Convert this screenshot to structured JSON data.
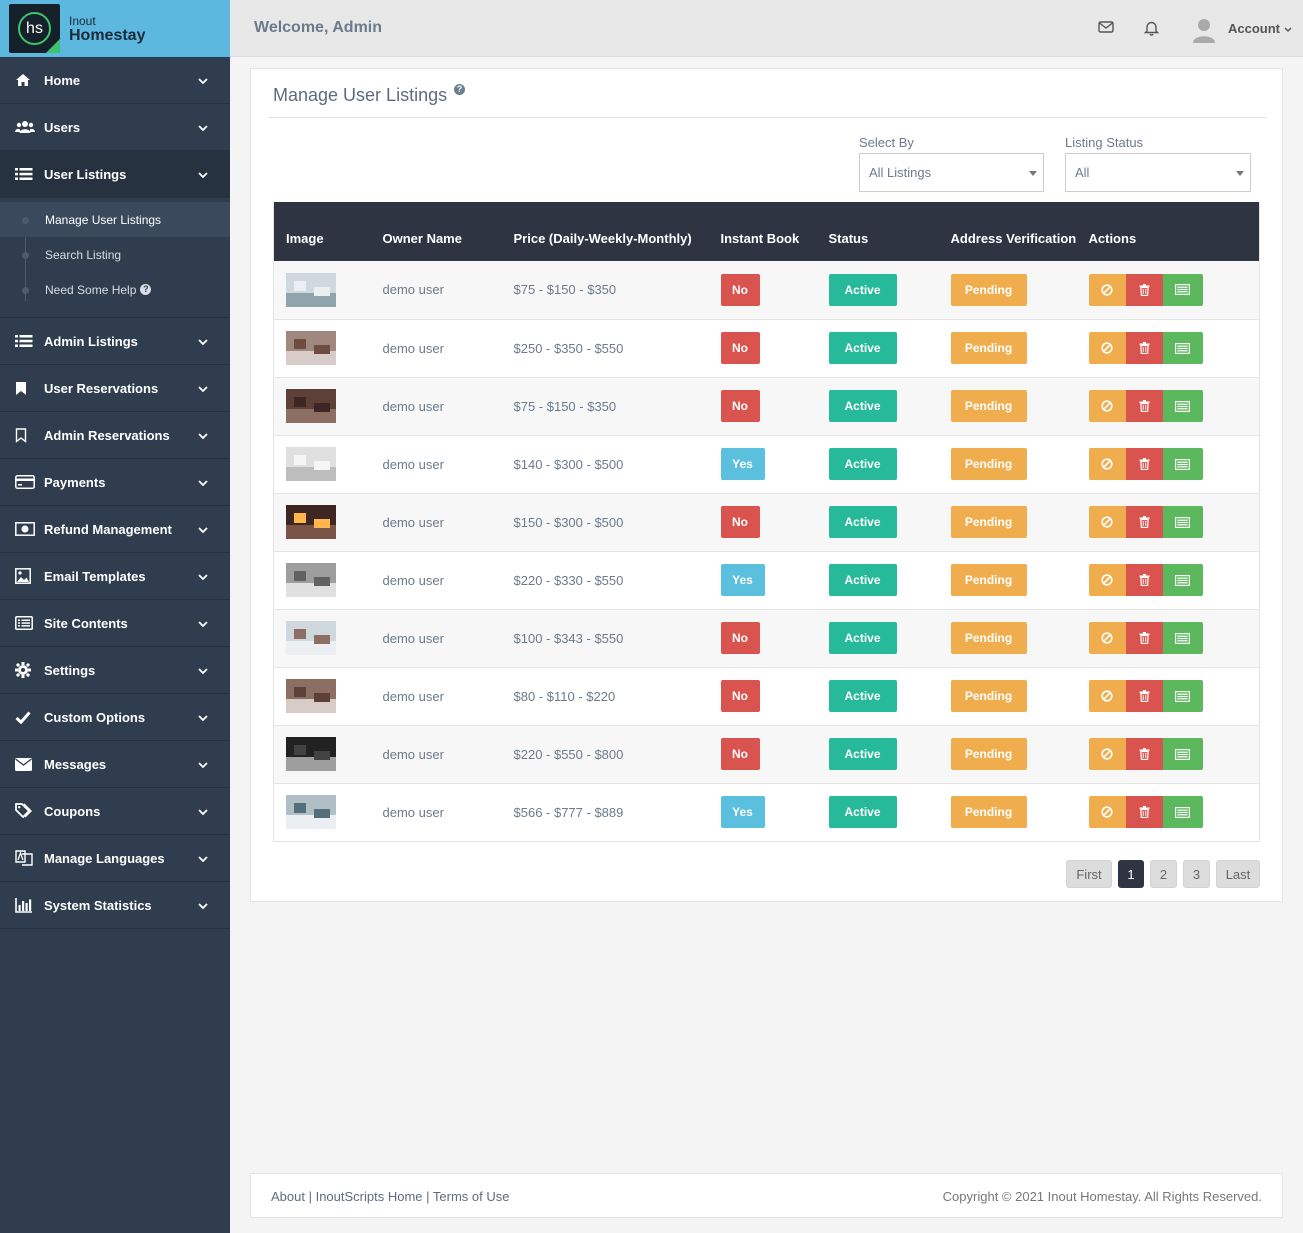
{
  "brand": {
    "logo_text": "hs",
    "line1": "Inout",
    "line2": "Homestay"
  },
  "topbar": {
    "welcome": "Welcome, Admin",
    "account": "Account"
  },
  "sidebar": {
    "items": [
      {
        "label": "Home",
        "icon": "home-icon"
      },
      {
        "label": "Users",
        "icon": "users-icon"
      },
      {
        "label": "User Listings",
        "icon": "list-icon"
      },
      {
        "label": "Admin Listings",
        "icon": "list-icon"
      },
      {
        "label": "User Reservations",
        "icon": "bookmark-icon"
      },
      {
        "label": "Admin Reservations",
        "icon": "bookmark-outline-icon"
      },
      {
        "label": "Payments",
        "icon": "credit-card-icon"
      },
      {
        "label": "Refund Management",
        "icon": "money-icon"
      },
      {
        "label": "Email Templates",
        "icon": "image-icon"
      },
      {
        "label": "Site Contents",
        "icon": "list-alt-icon"
      },
      {
        "label": "Settings",
        "icon": "gear-icon"
      },
      {
        "label": "Custom Options",
        "icon": "check-icon"
      },
      {
        "label": "Messages",
        "icon": "envelope-icon"
      },
      {
        "label": "Coupons",
        "icon": "tags-icon"
      },
      {
        "label": "Manage Languages",
        "icon": "language-icon"
      },
      {
        "label": "System Statistics",
        "icon": "bar-chart-icon"
      }
    ],
    "sub_items": [
      "Manage User Listings",
      "Search Listing",
      "Need Some Help"
    ]
  },
  "panel": {
    "title": "Manage User Listings",
    "select_by_label": "Select By",
    "select_by_value": "All Listings",
    "status_label": "Listing Status",
    "status_value": "All"
  },
  "table": {
    "headers": [
      "Image",
      "Owner Name",
      "Price (Daily-Weekly-Monthly)",
      "Instant Book",
      "Status",
      "Address Verification",
      "Actions"
    ],
    "rows": [
      {
        "owner": "demo user",
        "price": "$75 - $150 - $350",
        "instant": "No",
        "status": "Active",
        "verify": "Pending"
      },
      {
        "owner": "demo user",
        "price": "$250 - $350 - $550",
        "instant": "No",
        "status": "Active",
        "verify": "Pending"
      },
      {
        "owner": "demo user",
        "price": "$75 - $150 - $350",
        "instant": "No",
        "status": "Active",
        "verify": "Pending"
      },
      {
        "owner": "demo user",
        "price": "$140 - $300 - $500",
        "instant": "Yes",
        "status": "Active",
        "verify": "Pending"
      },
      {
        "owner": "demo user",
        "price": "$150 - $300 - $500",
        "instant": "No",
        "status": "Active",
        "verify": "Pending"
      },
      {
        "owner": "demo user",
        "price": "$220 - $330 - $550",
        "instant": "Yes",
        "status": "Active",
        "verify": "Pending"
      },
      {
        "owner": "demo user",
        "price": "$100 - $343 - $550",
        "instant": "No",
        "status": "Active",
        "verify": "Pending"
      },
      {
        "owner": "demo user",
        "price": "$80 - $110 - $220",
        "instant": "No",
        "status": "Active",
        "verify": "Pending"
      },
      {
        "owner": "demo user",
        "price": "$220 - $550 - $800",
        "instant": "No",
        "status": "Active",
        "verify": "Pending"
      },
      {
        "owner": "demo user",
        "price": "$566 - $777 - $889",
        "instant": "Yes",
        "status": "Active",
        "verify": "Pending"
      }
    ]
  },
  "pagination": {
    "first": "First",
    "pages": [
      "1",
      "2",
      "3"
    ],
    "last": "Last",
    "current": "1"
  },
  "footer": {
    "links": [
      "About",
      "InoutScripts Home",
      "Terms of Use"
    ],
    "copyright": "Copyright © 2021 Inout Homestay. All Rights Reserved."
  },
  "colors": {
    "sidebar": "#2f3d4e",
    "logo_bg": "#5cb8df",
    "no": "#d9534f",
    "yes": "#5bc0de",
    "active": "#26b99a",
    "pending": "#f0ad4e",
    "green": "#5cb85c"
  }
}
